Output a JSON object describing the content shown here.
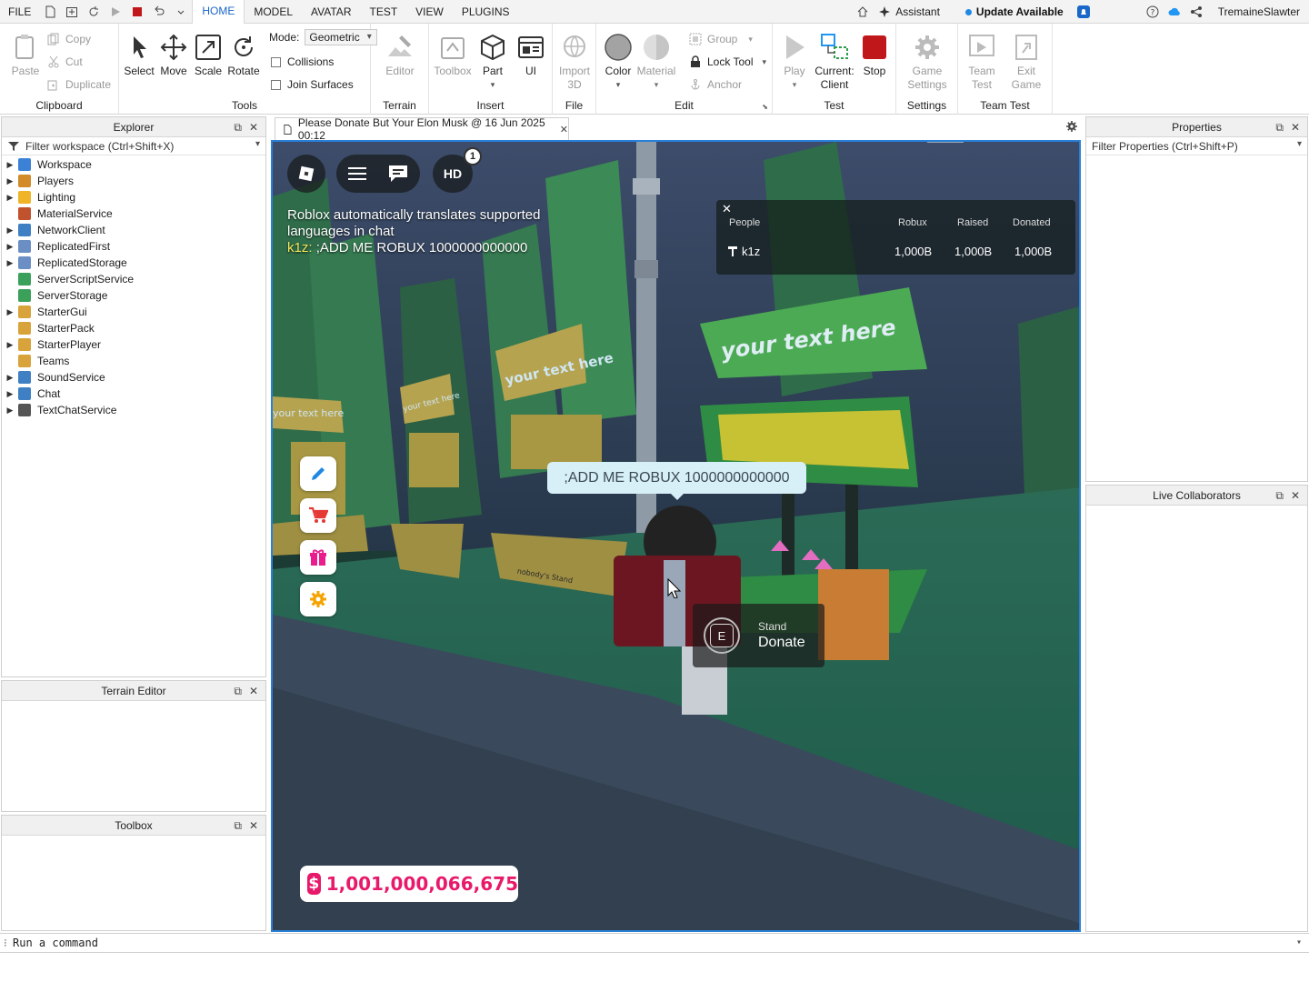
{
  "menubar": {
    "file": "FILE",
    "tabs": [
      "HOME",
      "MODEL",
      "AVATAR",
      "TEST",
      "VIEW",
      "PLUGINS"
    ],
    "assistant": "Assistant",
    "update": "Update Available",
    "username": "TremaineSlawter"
  },
  "ribbon": {
    "clipboard": {
      "label": "Clipboard",
      "paste": "Paste",
      "copy": "Copy",
      "cut": "Cut",
      "duplicate": "Duplicate"
    },
    "tools": {
      "label": "Tools",
      "select": "Select",
      "move": "Move",
      "scale": "Scale",
      "rotate": "Rotate",
      "mode_label": "Mode:",
      "mode_value": "Geometric",
      "collisions": "Collisions",
      "join_surfaces": "Join Surfaces"
    },
    "terrain": {
      "label": "Terrain",
      "editor": "Editor"
    },
    "insert": {
      "label": "Insert",
      "toolbox": "Toolbox",
      "part": "Part",
      "ui": "UI"
    },
    "file": {
      "label": "File",
      "import": "Import\n3D"
    },
    "edit": {
      "label": "Edit",
      "color": "Color",
      "material": "Material",
      "group": "Group",
      "lock_tool": "Lock Tool",
      "anchor": "Anchor"
    },
    "test": {
      "label": "Test",
      "play": "Play",
      "current": "Current:",
      "client": "Client",
      "stop": "Stop"
    },
    "settings": {
      "label": "Settings",
      "game": "Game",
      "settings_word": "Settings"
    },
    "team_test": {
      "label": "Team Test",
      "team": "Team",
      "test_word": "Test",
      "exit": "Exit",
      "game_word": "Game"
    }
  },
  "explorer": {
    "title": "Explorer",
    "filter": "Filter workspace (Ctrl+Shift+X)",
    "items": [
      {
        "label": "Workspace",
        "expandable": true,
        "color": "#3b82d6"
      },
      {
        "label": "Players",
        "expandable": true,
        "color": "#d28a2b"
      },
      {
        "label": "Lighting",
        "expandable": true,
        "color": "#f0b428"
      },
      {
        "label": "MaterialService",
        "expandable": false,
        "color": "#c0522e"
      },
      {
        "label": "NetworkClient",
        "expandable": true,
        "color": "#3f7fc4"
      },
      {
        "label": "ReplicatedFirst",
        "expandable": true,
        "color": "#6b8ec4"
      },
      {
        "label": "ReplicatedStorage",
        "expandable": true,
        "color": "#6b8ec4"
      },
      {
        "label": "ServerScriptService",
        "expandable": false,
        "color": "#3aa05a"
      },
      {
        "label": "ServerStorage",
        "expandable": false,
        "color": "#3aa05a"
      },
      {
        "label": "StarterGui",
        "expandable": true,
        "color": "#d8a33a"
      },
      {
        "label": "StarterPack",
        "expandable": false,
        "color": "#d8a33a"
      },
      {
        "label": "StarterPlayer",
        "expandable": true,
        "color": "#d8a33a"
      },
      {
        "label": "Teams",
        "expandable": false,
        "color": "#d8a33a"
      },
      {
        "label": "SoundService",
        "expandable": true,
        "color": "#3f7fc4"
      },
      {
        "label": "Chat",
        "expandable": true,
        "color": "#3f7fc4"
      },
      {
        "label": "TextChatService",
        "expandable": true,
        "color": "#555555"
      }
    ]
  },
  "terrain_editor": {
    "title": "Terrain Editor"
  },
  "toolbox_panel": {
    "title": "Toolbox"
  },
  "properties": {
    "title": "Properties",
    "filter": "Filter Properties (Ctrl+Shift+P)"
  },
  "live_collaborators": {
    "title": "Live Collaborators"
  },
  "document": {
    "tab_title": "Please Donate But Your Elon Musk @ 16 Jun 2025 00:12"
  },
  "game": {
    "hd_badge": "HD",
    "notification_count": "1",
    "chat_system": "Roblox automatically translates supported languages in chat",
    "chat_user": "k1z:",
    "chat_message": ";ADD ME ROBUX 1000000000000",
    "leaderboard": {
      "headers": [
        "People",
        "Robux",
        "Raised",
        "Donated"
      ],
      "rows": [
        {
          "name": "k1z",
          "robux": "1,000B",
          "raised": "1,000B",
          "donated": "1,000B"
        }
      ]
    },
    "bubble": ";ADD ME ROBUX 1000000000000",
    "prompt_key": "E",
    "prompt_object": "Stand",
    "prompt_action": "Donate",
    "sign_text_big": "your text here",
    "sign_text_mid": "your text here",
    "sign_text_small": "your text here",
    "sign_text_left": "your text here",
    "stand_label": "nobody's Stand",
    "money": "1,001,000,066,675"
  },
  "command_bar": {
    "placeholder": "Run a command"
  },
  "colors": {
    "accent": "#1a66c9",
    "viewport_border": "#2a7fd6",
    "money": "#e8196a",
    "stop": "#c0171b"
  }
}
